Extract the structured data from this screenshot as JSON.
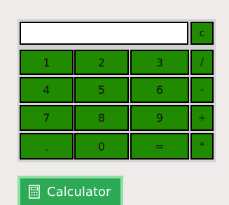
{
  "colors": {
    "page_background": "#efebeb",
    "keypad_background": "#d3d3d3",
    "key_green": "#208a00",
    "launcher_green": "#2daa56",
    "launcher_border": "#8fdfa7"
  },
  "display": {
    "value": ""
  },
  "keys": {
    "clear": "c",
    "k1": "1",
    "k2": "2",
    "k3": "3",
    "divide": "/",
    "k4": "4",
    "k5": "5",
    "k6": "6",
    "minus": "-",
    "k7": "7",
    "k8": "8",
    "k9": "9",
    "plus": "+",
    "dot": ".",
    "k0": "0",
    "equals": "=",
    "multiply": "*"
  },
  "launcher": {
    "icon": "calculator-icon",
    "label": "Calculator"
  }
}
